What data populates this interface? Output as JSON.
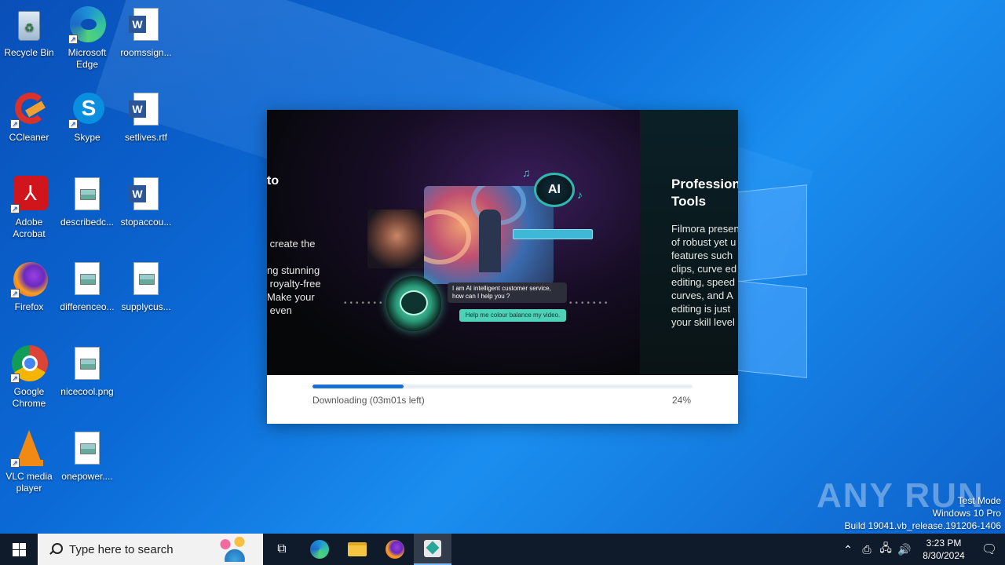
{
  "desktop": {
    "icons": [
      {
        "label": "Recycle Bin",
        "icon": "recycle-bin-icon"
      },
      {
        "label": "Microsoft Edge",
        "icon": "edge-icon"
      },
      {
        "label": "roomssign...",
        "icon": "word-doc-icon"
      },
      {
        "label": "CCleaner",
        "icon": "ccleaner-icon"
      },
      {
        "label": "Skype",
        "icon": "skype-icon"
      },
      {
        "label": "setlives.rtf",
        "icon": "word-doc-icon"
      },
      {
        "label": "Adobe Acrobat",
        "icon": "acrobat-icon"
      },
      {
        "label": "describedc...",
        "icon": "image-file-icon"
      },
      {
        "label": "stopaccou...",
        "icon": "word-doc-icon"
      },
      {
        "label": "Firefox",
        "icon": "firefox-icon"
      },
      {
        "label": "differenceo...",
        "icon": "image-file-icon"
      },
      {
        "label": "supplycus...",
        "icon": "image-file-icon"
      },
      {
        "label": "Google Chrome",
        "icon": "chrome-icon"
      },
      {
        "label": "nicecool.png",
        "icon": "image-file-icon"
      },
      {
        "label": "VLC media player",
        "icon": "vlc-icon"
      },
      {
        "label": "onepower....",
        "icon": "image-file-icon"
      }
    ]
  },
  "installer": {
    "slide_left": {
      "title": "to",
      "body": " create the\n\nng stunning\n royalty-free\nMake your\n even"
    },
    "slide_center": {
      "ai_badge": "AI",
      "chat_question": "I am AI intelligent customer service, how can I help you ?",
      "chat_reply": "Help me colour balance my video."
    },
    "slide_right": {
      "title": "Profession\nTools",
      "body": "Filmora presen\nof robust yet u\nfeatures such\nclips, curve ed\nediting, speed\ncurves, and A\nediting is just\nyour skill level"
    },
    "progress": {
      "label": "Downloading (03m01s left)",
      "percent_text": "24%",
      "fraction": 0.24
    }
  },
  "watermark": {
    "text": "ANY RUN",
    "mode": "Test Mode",
    "os": "Windows 10 Pro",
    "build": "Build 19041.vb_release.191206-1406"
  },
  "taskbar": {
    "search_placeholder": "Type here to search",
    "time": "3:23 PM",
    "date": "8/30/2024",
    "accent": "#0f1a2b"
  }
}
